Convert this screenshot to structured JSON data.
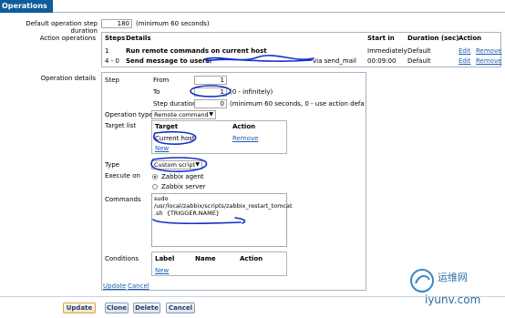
{
  "tab": {
    "label": "Operations"
  },
  "default_step": {
    "label": "Default operation step duration",
    "value": "180",
    "hint": "(minimum 60 seconds)"
  },
  "action_ops": {
    "label": "Action operations",
    "headers": {
      "steps": "Steps",
      "details": "Details",
      "start_in": "Start in",
      "duration": "Duration (sec)",
      "action": "Action"
    },
    "rows": [
      {
        "steps": "1",
        "details": "Run remote commands on current host",
        "details_suffix": "",
        "start_in": "Immediately",
        "duration": "Default",
        "edit": "Edit",
        "remove": "Remove"
      },
      {
        "steps": "4 - 0",
        "details": "Send message to users:",
        "details_suffix": "via send_mail",
        "start_in": "00:09:00",
        "duration": "Default",
        "edit": "Edit",
        "remove": "Remove"
      }
    ]
  },
  "op_details": {
    "label": "Operation details",
    "step": {
      "label": "Step",
      "from_label": "From",
      "from_value": "1",
      "to_label": "To",
      "to_value": "1",
      "to_hint": "(0 - infinitely)",
      "duration_label": "Step duration",
      "duration_value": "0",
      "duration_hint": "(minimum 60 seconds, 0 - use action default)"
    },
    "operation_type": {
      "label": "Operation type",
      "value": "Remote command"
    },
    "target_list": {
      "label": "Target list",
      "col_target": "Target",
      "col_action": "Action",
      "target": "Current host",
      "remove": "Remove",
      "new": "New"
    },
    "type": {
      "label": "Type",
      "value": "Custom script"
    },
    "execute_on": {
      "label": "Execute on",
      "options": [
        "Zabbix agent",
        "Zabbix server"
      ],
      "selected": "Zabbix agent"
    },
    "commands": {
      "label": "Commands",
      "value": "sudo\n/usr/local/zabbix/scripts/zabbix_restart_tomcat\n.sh  {TRIGGER.NAME}"
    },
    "conditions": {
      "label": "Conditions",
      "col_label": "Label",
      "col_name": "Name",
      "col_action": "Action",
      "new": "New"
    },
    "update_link": "Update",
    "cancel_link": "Cancel"
  },
  "footer": {
    "update": "Update",
    "clone": "Clone",
    "delete": "Delete",
    "cancel": "Cancel"
  },
  "watermark": {
    "text_cn": "运维网",
    "text_en": "iyunv.com"
  },
  "colors": {
    "tab_bg": "#0d5c9b",
    "link": "#1d5fb0",
    "ink": "#1530c9"
  }
}
